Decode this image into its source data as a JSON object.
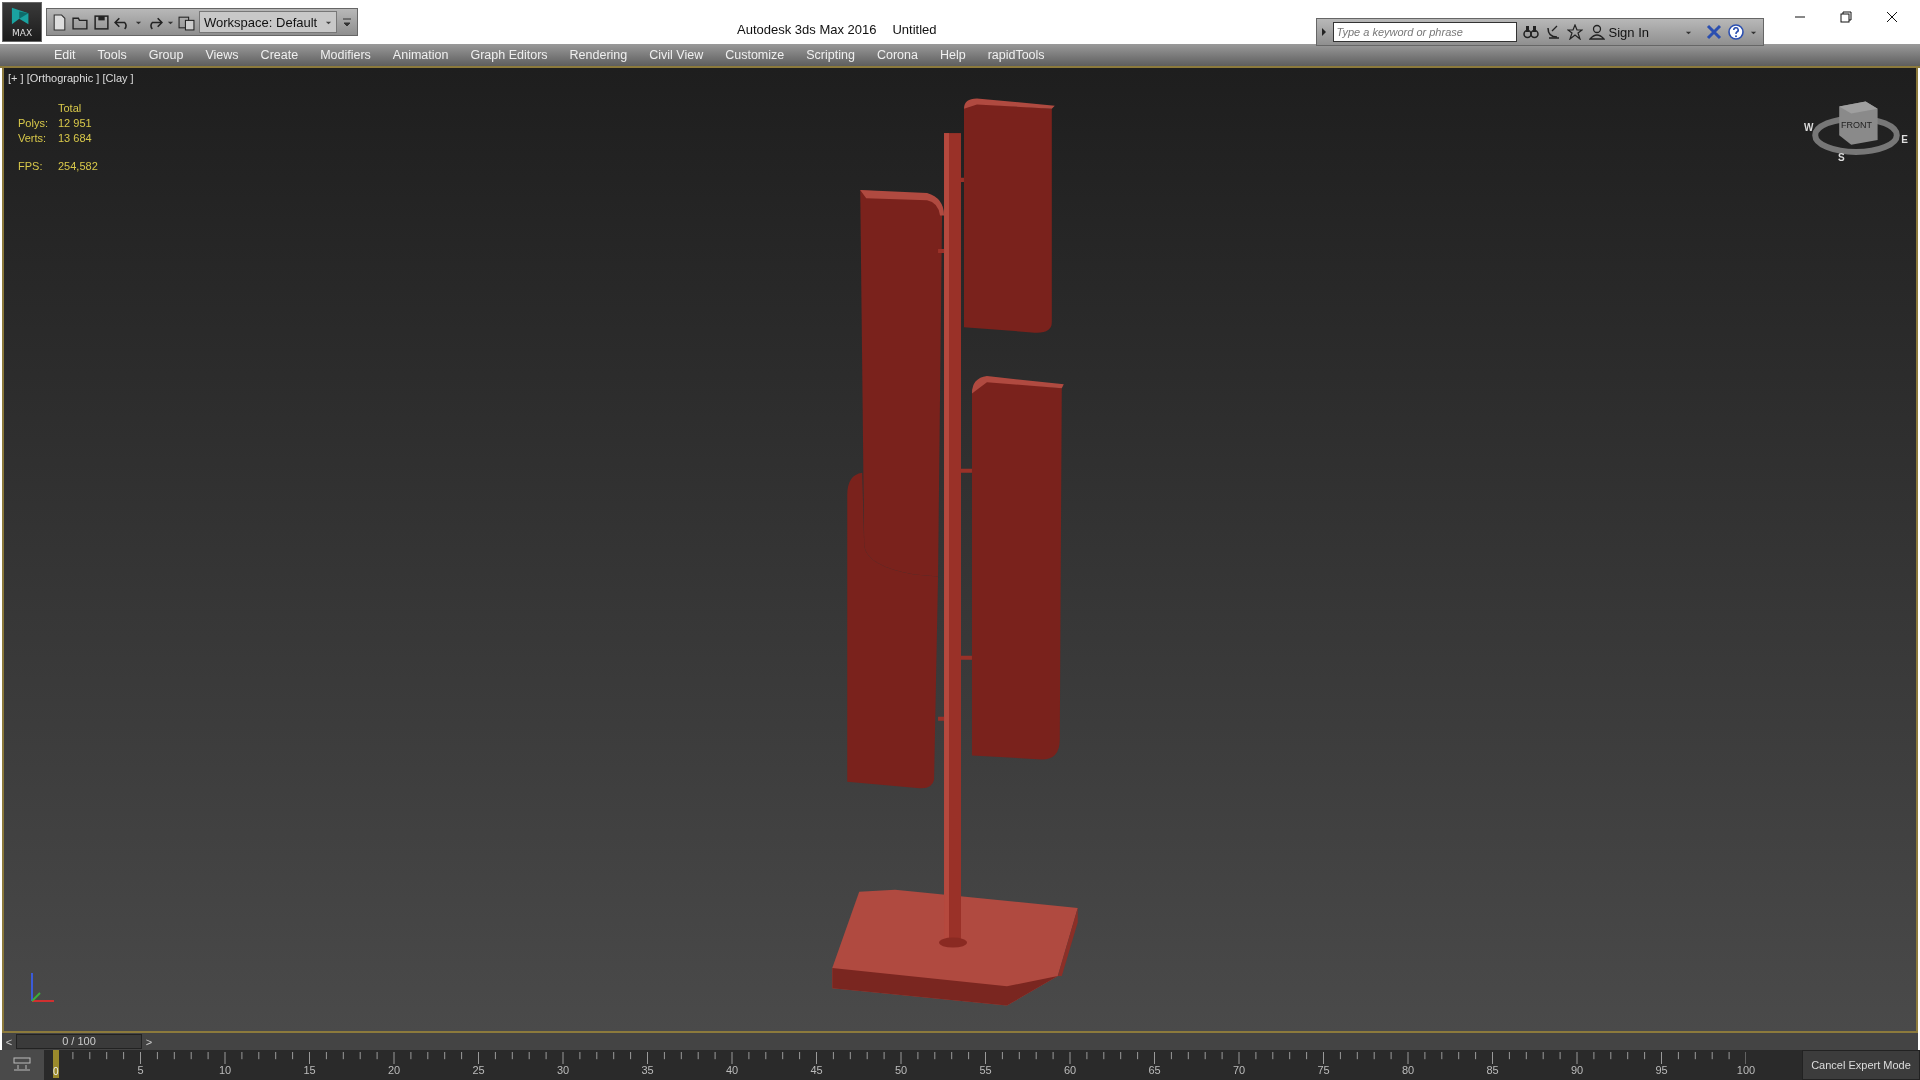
{
  "logo": "MAX",
  "toolbar": {
    "workspace": "Workspace: Default"
  },
  "window": {
    "app": "Autodesk 3ds Max 2016",
    "title": "Untitled"
  },
  "search": {
    "placeholder": "Type a keyword or phrase"
  },
  "sign_in": "Sign In",
  "menu": [
    "Edit",
    "Tools",
    "Group",
    "Views",
    "Create",
    "Modifiers",
    "Animation",
    "Graph Editors",
    "Rendering",
    "Civil View",
    "Customize",
    "Scripting",
    "Corona",
    "Help",
    "rapidTools"
  ],
  "viewport": {
    "label": "[+ ] [Orthographic ] [Clay ]",
    "stats_header": "Total",
    "stats": [
      {
        "label": "Polys:",
        "value": "12 951"
      },
      {
        "label": "Verts:",
        "value": "13 684"
      }
    ],
    "fps": {
      "label": "FPS:",
      "value": "254,582"
    },
    "viewcube": {
      "face": "FRONT",
      "compass": [
        "W",
        "E",
        "S"
      ]
    }
  },
  "time_slider": {
    "prev": "<",
    "label": "0 / 100",
    "next": ">",
    "level": 0
  },
  "track": {
    "current": "0",
    "labels": [
      "5",
      "10",
      "15",
      "20",
      "25",
      "30",
      "35",
      "40",
      "45",
      "50",
      "55",
      "60",
      "65",
      "70",
      "75",
      "80",
      "85",
      "90",
      "95",
      "100"
    ]
  },
  "cancel_button": "Cancel Expert Mode"
}
